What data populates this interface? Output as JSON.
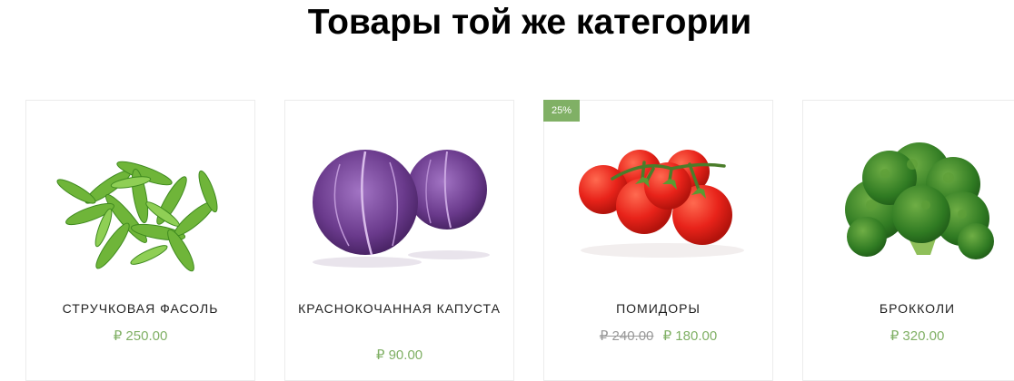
{
  "section": {
    "title": "Товары той же категории"
  },
  "products": [
    {
      "name": "Стручковая фасоль",
      "price": "₽ 250.00",
      "image": "green-beans-image"
    },
    {
      "name": "Краснокочанная капуста",
      "price": "₽ 90.00",
      "image": "red-cabbage-image"
    },
    {
      "name": "Помидоры",
      "old_price": "₽ 240.00",
      "price": "₽ 180.00",
      "badge": "25%",
      "image": "tomatoes-image"
    },
    {
      "name": "Брокколи",
      "price": "₽ 320.00",
      "image": "broccoli-image"
    }
  ],
  "colors": {
    "accent": "#80b065",
    "old_price": "#999999"
  }
}
